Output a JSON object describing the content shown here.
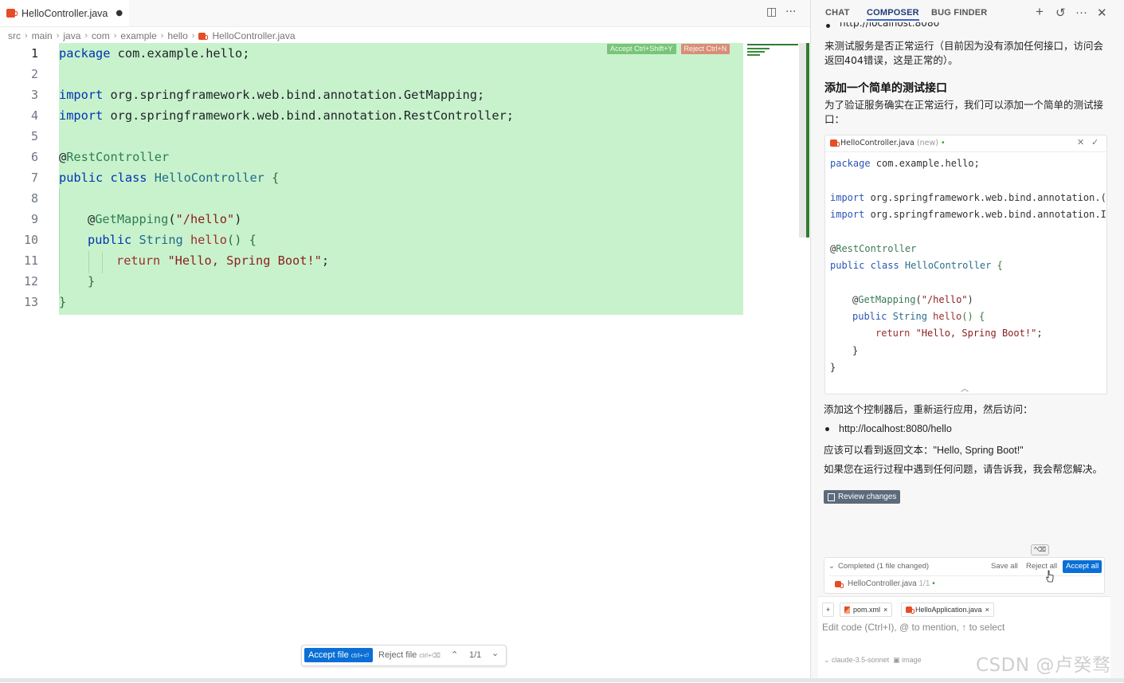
{
  "editor": {
    "tab": {
      "filename": "HelloController.java",
      "dirty_marker": "●"
    },
    "breadcrumb": [
      "src",
      "main",
      "java",
      "com",
      "example",
      "hello",
      "HelloController.java"
    ],
    "inline_accept": "Accept Ctrl+Shift+Y",
    "inline_reject": "Reject Ctrl+N",
    "line_numbers": [
      "1",
      "2",
      "3",
      "4",
      "5",
      "6",
      "7",
      "8",
      "9",
      "10",
      "11",
      "12",
      "13"
    ],
    "code": {
      "l1_kw": "package",
      "l1_rest": " com.example.hello;",
      "l3_kw": "import",
      "l3_rest": " org.springframework.web.bind.annotation.GetMapping;",
      "l4_kw": "import",
      "l4_rest": " org.springframework.web.bind.annotation.RestController;",
      "l6_at": "@",
      "l6_ann": "RestController",
      "l7_kw": "public class",
      "l7_cls": " HelloController",
      "l7_brace": " {",
      "l9_at": "@",
      "l9_ann": "GetMapping",
      "l9_open": "(",
      "l9_str": "\"/hello\"",
      "l9_close": ")",
      "l10_kw": "public",
      "l10_type": " String",
      "l10_name": " hello",
      "l10_rest": "() {",
      "l11_ret": "return",
      "l11_str": " \"Hello, Spring Boot!\"",
      "l11_semi": ";",
      "l12": "}",
      "l13": "}"
    },
    "file_actions": {
      "accept": "Accept file",
      "accept_kbd": "ctrl+⏎",
      "reject": "Reject file",
      "reject_kbd": "ctrl+⌫",
      "up": "⌃",
      "counter": "1/1",
      "down": "⌄"
    }
  },
  "panel": {
    "tabs": [
      "CHAT",
      "COMPOSER",
      "BUG FINDER"
    ],
    "active_tab": "COMPOSER",
    "icons": [
      "plus-icon",
      "history-icon",
      "more-icon",
      "close-icon"
    ],
    "chat": {
      "top_url": "http://localhost:8080",
      "p1": "来测试服务是否正常运行（目前因为没有添加任何接口，访问会返回404错误，这是正常的）。",
      "heading": "添加一个简单的测试接口",
      "p2": "为了验证服务确实在正常运行，我们可以添加一个简单的测试接口：",
      "card": {
        "filename": "HelloController.java",
        "new_tag": " (new)",
        "dot": " •",
        "lines": {
          "c1_kw": "package",
          "c1_rest": " com.example.hello;",
          "c3_kw": "import",
          "c3_rest": " org.springframework.web.bind.annotation.(",
          "c4_kw": "import",
          "c4_rest": " org.springframework.web.bind.annotation.I",
          "c6_at": "@",
          "c6_ann": "RestController",
          "c7_kw": "public class",
          "c7_cls": " HelloController",
          "c7_brace": " {",
          "c9_at": "@",
          "c9_ann": "GetMapping",
          "c9_open": "(",
          "c9_str": "\"/hello\"",
          "c9_close": ")",
          "c10_kw": "public",
          "c10_type": " String",
          "c10_name": " hello",
          "c10_rest": "() {",
          "c11_ret": "return",
          "c11_str": " \"Hello, Spring Boot!\"",
          "c11_semi": ";",
          "c12": "}",
          "c13": "}"
        }
      },
      "p3": "添加这个控制器后，重新运行应用，然后访问：",
      "url2": "http://localhost:8080/hello",
      "p4": "应该可以看到返回文本：\"Hello, Spring Boot!\"",
      "p5": "如果您在运行过程中遇到任何问题，请告诉我，我会帮您解决。",
      "review_changes": "Review changes"
    },
    "status": {
      "kbd_tip": "^⌫",
      "completed": "Completed (1 file changed)",
      "save_all": "Save all",
      "reject_all": "Reject all",
      "accept_all": "Accept all",
      "file": "HelloController.java",
      "file_count": "1/1",
      "file_dot": "•"
    },
    "composer": {
      "add": "+",
      "chips": [
        "pom.xml",
        "HelloApplication.java"
      ],
      "placeholder": "Edit code (Ctrl+I), @ to mention, ↑ to select",
      "model": "claude-3.5-sonnet",
      "image_label": "image"
    }
  },
  "watermark": "CSDN @卢癸骛",
  "colors": {
    "added_bg": "#c8f2cc",
    "accent": "#0a6fd6",
    "diff_bar": "#2f7d32"
  }
}
